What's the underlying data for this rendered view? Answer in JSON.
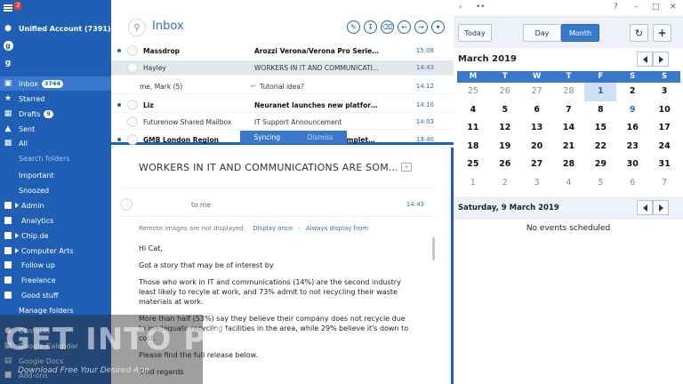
{
  "sidebar": {
    "notif_badge": "2",
    "account": "Unified Account (7391)",
    "items": [
      {
        "label": "Inbox",
        "count": "3744"
      },
      {
        "label": "Starred"
      },
      {
        "label": "Drafts",
        "count": "9"
      },
      {
        "label": "Sent"
      },
      {
        "label": "All"
      },
      {
        "label": "Search folders"
      },
      {
        "label": "Important"
      },
      {
        "label": "Snoozed"
      },
      {
        "label": "Admin"
      },
      {
        "label": "Analytics"
      },
      {
        "label": "Chip.de"
      },
      {
        "label": "Computer Arts"
      },
      {
        "label": "Follow up"
      },
      {
        "label": "Freelance"
      },
      {
        "label": "Good stuff"
      },
      {
        "label": "Manage folders"
      },
      {
        "label": "Contacts"
      },
      {
        "label": "Google Calendar"
      },
      {
        "label": "Google Docs"
      },
      {
        "label": "Add-ons"
      }
    ]
  },
  "list": {
    "title": "Inbox",
    "sync_label": "Syncing",
    "dismiss_label": "Dismiss",
    "rows": [
      {
        "from": "Massdrop",
        "subject": "Arozzi Verona/Verona Pro Series Gam...",
        "time": "15:08",
        "unread": true
      },
      {
        "from": "Hayley",
        "subject": "WORKERS IN IT AND COMMUNICATI...",
        "time": "14:43",
        "unread": false,
        "selected": true
      },
      {
        "from": "me, Mark  (5)",
        "subject": "Tutorial idea?",
        "time": "14:12",
        "unread": false,
        "reply": true
      },
      {
        "from": "Liz",
        "subject": "Neuranet launches new platform, hel...",
        "time": "14:10",
        "unread": true
      },
      {
        "from": "Futurenow Shared Mailbox",
        "subject": "IT Support Announcement",
        "time": "14:03",
        "unread": false
      },
      {
        "from": "GMB London Region",
        "subject": "...llings completed in L...",
        "time": "13:40",
        "unread": true
      }
    ]
  },
  "reader": {
    "subject": "WORKERS IN IT AND COMMUNICATIONS ARE SOM...",
    "to": "to me",
    "time": "14:43",
    "remote_notice": "Remote images are not displayed.",
    "display_once": "Display once",
    "always_display": "Always display from",
    "body": [
      "Hi Cat,",
      "Got a story that may be of interest by",
      "Those who work in IT and communications (14%) are the second industry least likely to recyle at work, and 73% admit to not recycling their waste materials at work.",
      "More than half (53%) say they believe their company does not recycle due to inadequate recycling facilities in the area, while 29% believe it's down to cost.",
      "Please find the full release below.",
      "Kind regards"
    ]
  },
  "calendar": {
    "win_help": "?",
    "today_label": "Today",
    "day_label": "Day",
    "month_label": "Month",
    "month_title": "March 2019",
    "weekdays": [
      "M",
      "T",
      "W",
      "T",
      "F",
      "S",
      "S"
    ],
    "days": [
      "25",
      "26",
      "27",
      "28",
      "1",
      "2",
      "3",
      "4",
      "5",
      "6",
      "7",
      "8",
      "9",
      "10",
      "11",
      "12",
      "13",
      "14",
      "15",
      "16",
      "17",
      "18",
      "19",
      "20",
      "21",
      "22",
      "23",
      "24",
      "25",
      "26",
      "27",
      "28",
      "29",
      "30",
      "31",
      "1",
      "2",
      "3",
      "4",
      "5",
      "6",
      "7"
    ],
    "selected_date": "Saturday, 9 March 2019",
    "no_events": "No events scheduled"
  },
  "watermark": {
    "big": "GET INTO PC",
    "small": "Download Free Your Desired App"
  }
}
